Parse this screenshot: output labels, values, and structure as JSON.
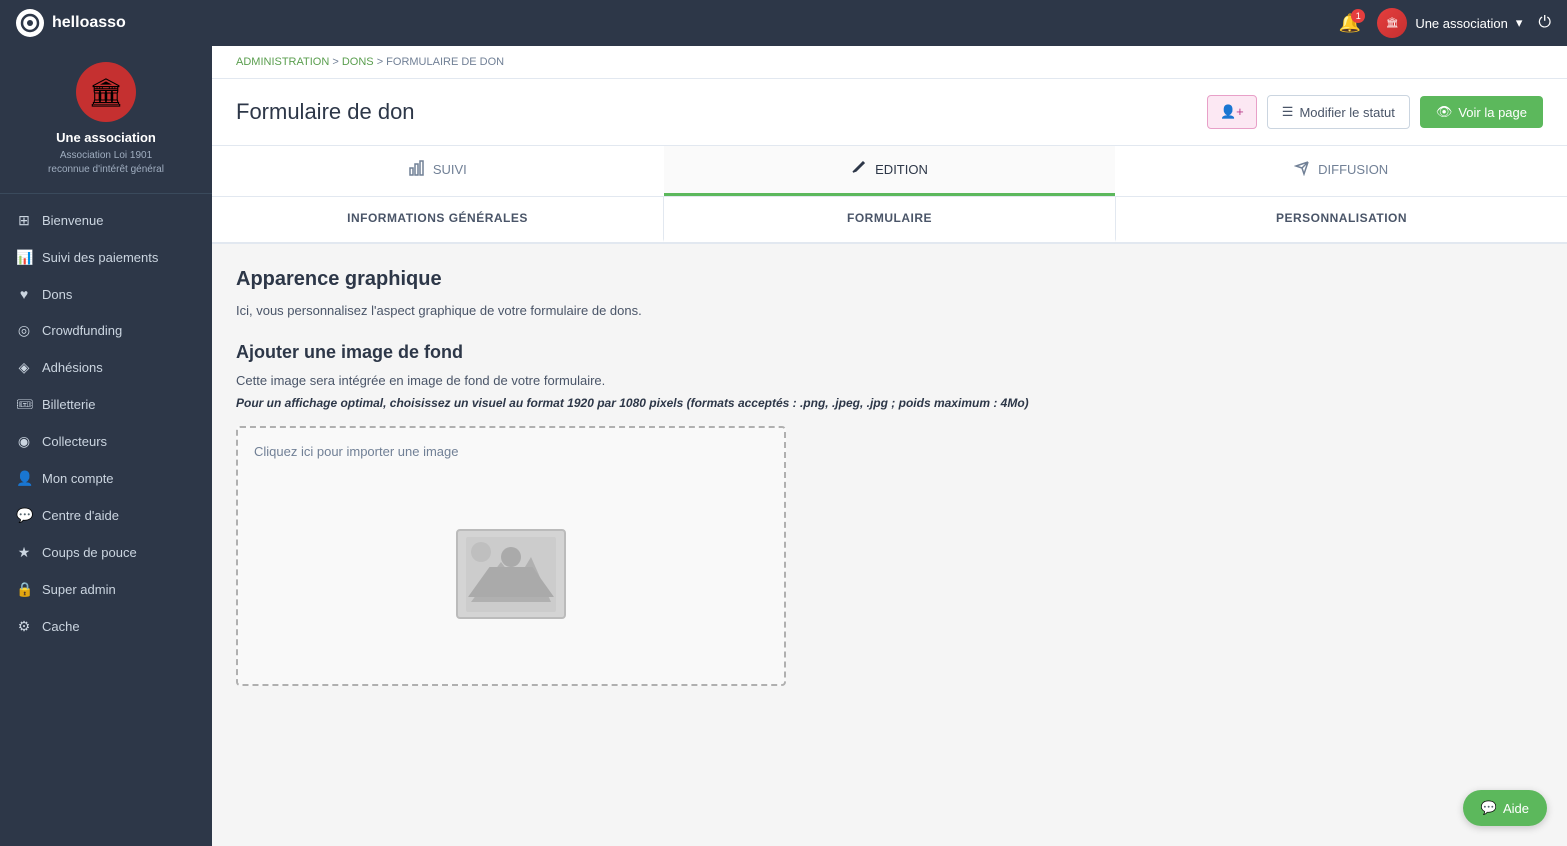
{
  "topnav": {
    "brand": "helloasso",
    "logo_text": "○",
    "notif_count": "1",
    "user_name": "Une association",
    "chevron": "▾"
  },
  "sidebar": {
    "org_name": "Une association",
    "org_sub1": "Association Loi 1901",
    "org_sub2": "reconnue d'intérêt général",
    "nav_items": [
      {
        "id": "bienvenue",
        "label": "Bienvenue",
        "icon": "⊞"
      },
      {
        "id": "suivi-paiements",
        "label": "Suivi des paiements",
        "icon": "📊"
      },
      {
        "id": "dons",
        "label": "Dons",
        "icon": "♥"
      },
      {
        "id": "crowdfunding",
        "label": "Crowdfunding",
        "icon": "✈"
      },
      {
        "id": "adhesions",
        "label": "Adhésions",
        "icon": "✈"
      },
      {
        "id": "billetterie",
        "label": "Billetterie",
        "icon": "🎟"
      },
      {
        "id": "collecteurs",
        "label": "Collecteurs",
        "icon": "◎"
      },
      {
        "id": "mon-compte",
        "label": "Mon compte",
        "icon": "👤"
      },
      {
        "id": "centre-aide",
        "label": "Centre d'aide",
        "icon": "💬"
      },
      {
        "id": "coups-pouce",
        "label": "Coups de pouce",
        "icon": "★"
      },
      {
        "id": "super-admin",
        "label": "Super admin",
        "icon": "🔒"
      },
      {
        "id": "cache",
        "label": "Cache",
        "icon": "⚙"
      }
    ]
  },
  "breadcrumb": {
    "items": [
      {
        "label": "ADMINISTRATION",
        "link": true
      },
      {
        "label": "DONS",
        "link": true
      },
      {
        "label": "FORMULAIRE DE DON",
        "link": false
      }
    ]
  },
  "page": {
    "title": "Formulaire de don",
    "actions": {
      "add_member_icon": "👤+",
      "modifier_statut_icon": "☰",
      "modifier_statut_label": "Modifier le statut",
      "voir_page_icon": "👁",
      "voir_page_label": "Voir la page"
    }
  },
  "tabs_primary": [
    {
      "id": "suivi",
      "label": "SUIVI",
      "icon": "📊",
      "active": false
    },
    {
      "id": "edition",
      "label": "EDITION",
      "icon": "✏",
      "active": true
    },
    {
      "id": "diffusion",
      "label": "DIFFUSION",
      "icon": "✈",
      "active": false
    }
  ],
  "tabs_secondary": [
    {
      "id": "informations-generales",
      "label": "INFORMATIONS GÉNÉRALES"
    },
    {
      "id": "formulaire",
      "label": "FORMULAIRE"
    },
    {
      "id": "personnalisation",
      "label": "PERSONNALISATION"
    }
  ],
  "content": {
    "section_title": "Apparence graphique",
    "section_desc": "Ici, vous personnalisez l'aspect graphique de votre formulaire de dons.",
    "subsection_title": "Ajouter une image de fond",
    "subsection_desc": "Cette image sera intégrée en image de fond de votre formulaire.",
    "subsection_note": "Pour un affichage optimal, choisissez un visuel au format 1920 par 1080 pixels (formats acceptés : .png, .jpeg, .jpg ; poids maximum : 4Mo)",
    "upload_hint": "Cliquez ici pour importer une image"
  },
  "help": {
    "label": "Aide",
    "icon": "💬"
  }
}
